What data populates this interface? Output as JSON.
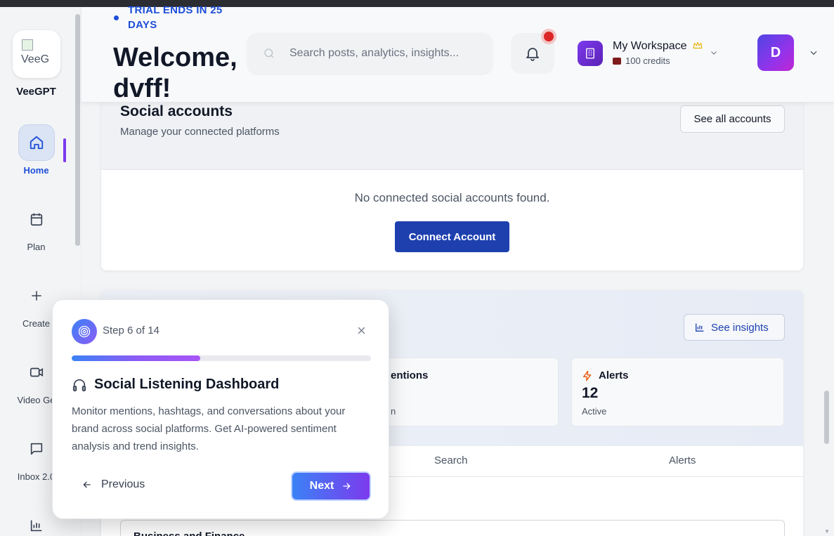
{
  "sidebar": {
    "logo_alt": "VeeG",
    "brand": "VeeGPT",
    "items": [
      {
        "label": "Home",
        "icon": "home-icon",
        "active": true
      },
      {
        "label": "Plan",
        "icon": "calendar-icon"
      },
      {
        "label": "Create",
        "icon": "plus-icon"
      },
      {
        "label": "Video Ge",
        "icon": "video-icon"
      },
      {
        "label": "Inbox 2.0",
        "icon": "chat-icon"
      },
      {
        "label": "",
        "icon": "bar-chart-icon"
      }
    ]
  },
  "header": {
    "trial": "TRIAL ENDS IN 25 DAYS",
    "welcome": "Welcome, dvff!",
    "search_placeholder": "Search posts, analytics, insights...",
    "workspace_name": "My Workspace",
    "credits": "100 credits",
    "avatar_initial": "D"
  },
  "social_accounts": {
    "title": "Social accounts",
    "subtitle": "Manage your connected platforms",
    "see_all": "See all accounts",
    "empty": "No connected social accounts found.",
    "connect": "Connect Account"
  },
  "listening": {
    "see_insights": "See insights",
    "mentions_label": "entions",
    "mentions_sub": "n",
    "alerts_label": "Alerts",
    "alerts_value": "12",
    "alerts_sub": "Active",
    "tabs": [
      "Search",
      "Alerts"
    ],
    "select_value": "Business and Finance"
  },
  "tour": {
    "step": "Step 6 of 14",
    "progress": 0.4286,
    "title": "Social Listening Dashboard",
    "description": "Monitor mentions, hashtags, and conversations about your brand across social platforms. Get AI-powered sentiment analysis and trend insights.",
    "previous": "Previous",
    "next": "Next"
  },
  "colors": {
    "accent": "#1e40af",
    "brand_purple": "#7c3aed",
    "alert_orange": "#ea580c",
    "badge_red": "#dc2626"
  }
}
